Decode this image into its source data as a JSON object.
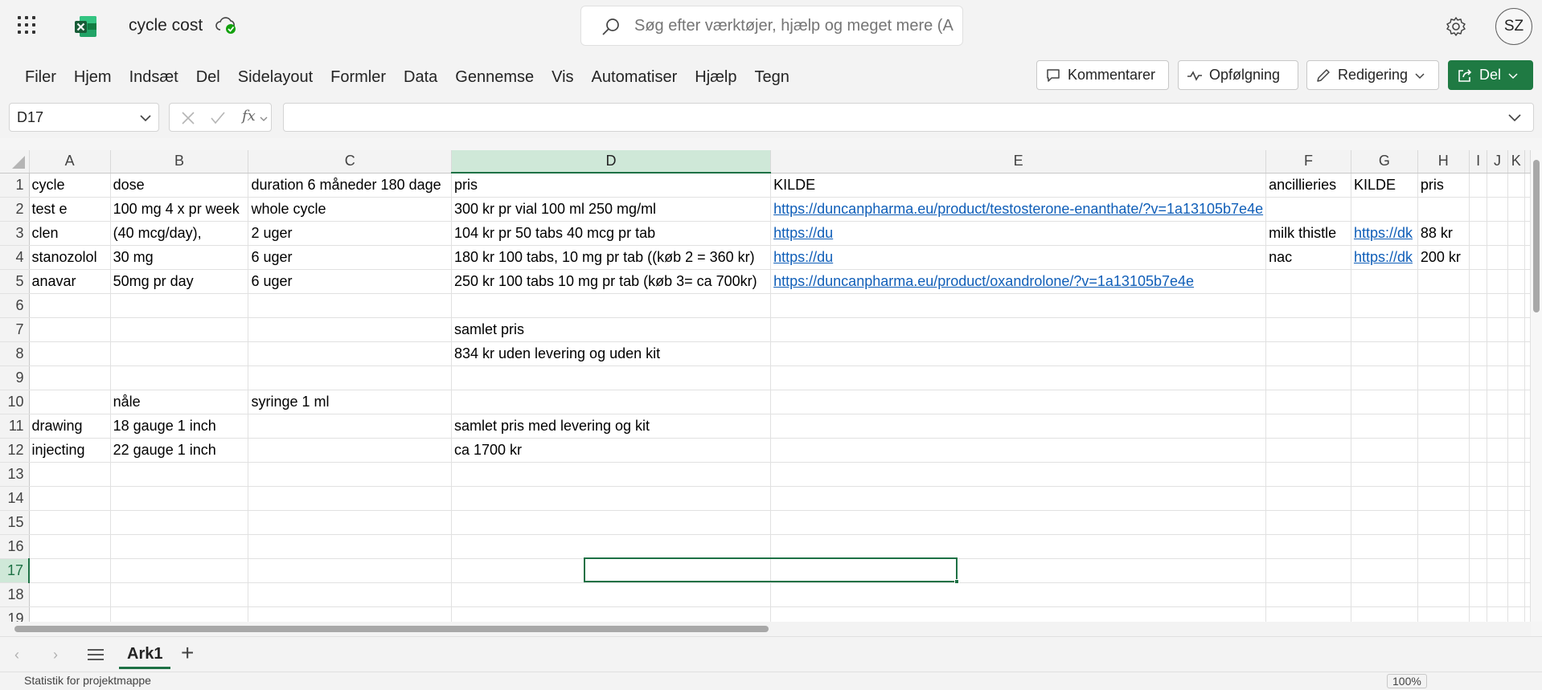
{
  "app": {
    "document_title": "cycle cost",
    "search_placeholder": "Søg efter værktøjer, hjælp og meget mere (A",
    "user_initials": "SZ"
  },
  "ribbon": {
    "tabs": [
      "Filer",
      "Hjem",
      "Indsæt",
      "Del",
      "Sidelayout",
      "Formler",
      "Data",
      "Gennemse",
      "Vis",
      "Automatiser",
      "Hjælp",
      "Tegn"
    ],
    "comments_label": "Kommentarer",
    "followup_label": "Opfølgning",
    "editing_label": "Redigering",
    "share_label": "Del"
  },
  "formula_bar": {
    "name_box": "D17",
    "fx": "fx",
    "formula": ""
  },
  "grid": {
    "columns": [
      "A",
      "B",
      "C",
      "D",
      "E",
      "F",
      "G",
      "H",
      "I",
      "J",
      "K"
    ],
    "selected_column": "D",
    "selected_row": "17",
    "rows": [
      {
        "n": "1",
        "cells": {
          "A": "cycle",
          "B": "dose",
          "C": "duration 6 måneder 180 dage",
          "D": "pris",
          "E": "KILDE",
          "F": "ancillieries",
          "G": "KILDE",
          "H": "pris"
        }
      },
      {
        "n": "2",
        "cells": {
          "A": "test e",
          "B": "100 mg 4 x pr week",
          "C": "whole cycle",
          "D": "300 kr pr  vial 100 ml 250 mg/ml",
          "E": "https://duncanpharma.eu/product/testosterone-enanthate/?v=1a13105b7e4e"
        }
      },
      {
        "n": "3",
        "cells": {
          "A": "clen",
          "B": "(40 mcg/day),",
          "C": "2 uger",
          "D": "104 kr pr 50 tabs 40 mcg pr tab",
          "E": "https://du",
          "F": "milk thistle",
          "G": "https://dk",
          "H": "88 kr"
        }
      },
      {
        "n": "4",
        "cells": {
          "A": "stanozolol",
          "B": "30 mg",
          "C": "6 uger",
          "D": "180 kr 100 tabs, 10 mg pr tab ((køb 2 = 360 kr)",
          "E": "https://du",
          "F": "nac",
          "G": "https://dk",
          "H": "200 kr"
        }
      },
      {
        "n": "5",
        "cells": {
          "A": "anavar",
          "B": " 50mg pr day",
          "C": "6 uger",
          "D": "250 kr 100 tabs 10 mg pr tab (køb 3= ca 700kr)",
          "E": "https://duncanpharma.eu/product/oxandrolone/?v=1a13105b7e4e"
        }
      },
      {
        "n": "6",
        "cells": {}
      },
      {
        "n": "7",
        "cells": {
          "D": "samlet pris"
        }
      },
      {
        "n": "8",
        "cells": {
          "D": "834 kr uden levering og uden kit"
        }
      },
      {
        "n": "9",
        "cells": {}
      },
      {
        "n": "10",
        "cells": {
          "B": "nåle",
          "C": "syringe 1 ml"
        }
      },
      {
        "n": "11",
        "cells": {
          "A": "drawing",
          "B": "18 gauge 1 inch",
          "D": "samlet pris med levering og kit"
        }
      },
      {
        "n": "12",
        "cells": {
          "A": "injecting",
          "B": "22 gauge 1 inch",
          "D": "ca 1700 kr"
        }
      },
      {
        "n": "13",
        "cells": {}
      },
      {
        "n": "14",
        "cells": {}
      },
      {
        "n": "15",
        "cells": {}
      },
      {
        "n": "16",
        "cells": {}
      },
      {
        "n": "17",
        "cells": {}
      },
      {
        "n": "18",
        "cells": {}
      },
      {
        "n": "19",
        "cells": {}
      }
    ],
    "link_cells": [
      "E2",
      "E3",
      "G3",
      "E4",
      "G4",
      "E5"
    ],
    "clipped_cells": [
      "E3",
      "G3",
      "E4",
      "G4"
    ]
  },
  "sheets": {
    "tabs": [
      "Ark1"
    ],
    "active": "Ark1"
  },
  "status_bar": {
    "text": "Statistik for projektmappe",
    "zoom": "100%"
  },
  "colors": {
    "accent": "#1e7145",
    "link": "#0f5eb8",
    "share_button": "#1f7a43"
  }
}
